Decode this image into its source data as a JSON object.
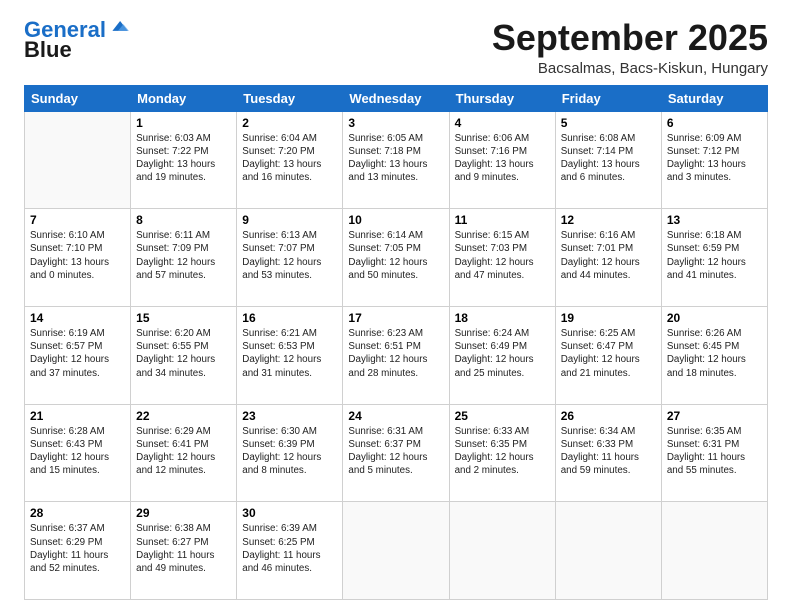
{
  "header": {
    "logo_line1": "General",
    "logo_line2": "Blue",
    "month": "September 2025",
    "location": "Bacsalmas, Bacs-Kiskun, Hungary"
  },
  "weekdays": [
    "Sunday",
    "Monday",
    "Tuesday",
    "Wednesday",
    "Thursday",
    "Friday",
    "Saturday"
  ],
  "weeks": [
    [
      {
        "num": "",
        "text": ""
      },
      {
        "num": "1",
        "text": "Sunrise: 6:03 AM\nSunset: 7:22 PM\nDaylight: 13 hours\nand 19 minutes."
      },
      {
        "num": "2",
        "text": "Sunrise: 6:04 AM\nSunset: 7:20 PM\nDaylight: 13 hours\nand 16 minutes."
      },
      {
        "num": "3",
        "text": "Sunrise: 6:05 AM\nSunset: 7:18 PM\nDaylight: 13 hours\nand 13 minutes."
      },
      {
        "num": "4",
        "text": "Sunrise: 6:06 AM\nSunset: 7:16 PM\nDaylight: 13 hours\nand 9 minutes."
      },
      {
        "num": "5",
        "text": "Sunrise: 6:08 AM\nSunset: 7:14 PM\nDaylight: 13 hours\nand 6 minutes."
      },
      {
        "num": "6",
        "text": "Sunrise: 6:09 AM\nSunset: 7:12 PM\nDaylight: 13 hours\nand 3 minutes."
      }
    ],
    [
      {
        "num": "7",
        "text": "Sunrise: 6:10 AM\nSunset: 7:10 PM\nDaylight: 13 hours\nand 0 minutes."
      },
      {
        "num": "8",
        "text": "Sunrise: 6:11 AM\nSunset: 7:09 PM\nDaylight: 12 hours\nand 57 minutes."
      },
      {
        "num": "9",
        "text": "Sunrise: 6:13 AM\nSunset: 7:07 PM\nDaylight: 12 hours\nand 53 minutes."
      },
      {
        "num": "10",
        "text": "Sunrise: 6:14 AM\nSunset: 7:05 PM\nDaylight: 12 hours\nand 50 minutes."
      },
      {
        "num": "11",
        "text": "Sunrise: 6:15 AM\nSunset: 7:03 PM\nDaylight: 12 hours\nand 47 minutes."
      },
      {
        "num": "12",
        "text": "Sunrise: 6:16 AM\nSunset: 7:01 PM\nDaylight: 12 hours\nand 44 minutes."
      },
      {
        "num": "13",
        "text": "Sunrise: 6:18 AM\nSunset: 6:59 PM\nDaylight: 12 hours\nand 41 minutes."
      }
    ],
    [
      {
        "num": "14",
        "text": "Sunrise: 6:19 AM\nSunset: 6:57 PM\nDaylight: 12 hours\nand 37 minutes."
      },
      {
        "num": "15",
        "text": "Sunrise: 6:20 AM\nSunset: 6:55 PM\nDaylight: 12 hours\nand 34 minutes."
      },
      {
        "num": "16",
        "text": "Sunrise: 6:21 AM\nSunset: 6:53 PM\nDaylight: 12 hours\nand 31 minutes."
      },
      {
        "num": "17",
        "text": "Sunrise: 6:23 AM\nSunset: 6:51 PM\nDaylight: 12 hours\nand 28 minutes."
      },
      {
        "num": "18",
        "text": "Sunrise: 6:24 AM\nSunset: 6:49 PM\nDaylight: 12 hours\nand 25 minutes."
      },
      {
        "num": "19",
        "text": "Sunrise: 6:25 AM\nSunset: 6:47 PM\nDaylight: 12 hours\nand 21 minutes."
      },
      {
        "num": "20",
        "text": "Sunrise: 6:26 AM\nSunset: 6:45 PM\nDaylight: 12 hours\nand 18 minutes."
      }
    ],
    [
      {
        "num": "21",
        "text": "Sunrise: 6:28 AM\nSunset: 6:43 PM\nDaylight: 12 hours\nand 15 minutes."
      },
      {
        "num": "22",
        "text": "Sunrise: 6:29 AM\nSunset: 6:41 PM\nDaylight: 12 hours\nand 12 minutes."
      },
      {
        "num": "23",
        "text": "Sunrise: 6:30 AM\nSunset: 6:39 PM\nDaylight: 12 hours\nand 8 minutes."
      },
      {
        "num": "24",
        "text": "Sunrise: 6:31 AM\nSunset: 6:37 PM\nDaylight: 12 hours\nand 5 minutes."
      },
      {
        "num": "25",
        "text": "Sunrise: 6:33 AM\nSunset: 6:35 PM\nDaylight: 12 hours\nand 2 minutes."
      },
      {
        "num": "26",
        "text": "Sunrise: 6:34 AM\nSunset: 6:33 PM\nDaylight: 11 hours\nand 59 minutes."
      },
      {
        "num": "27",
        "text": "Sunrise: 6:35 AM\nSunset: 6:31 PM\nDaylight: 11 hours\nand 55 minutes."
      }
    ],
    [
      {
        "num": "28",
        "text": "Sunrise: 6:37 AM\nSunset: 6:29 PM\nDaylight: 11 hours\nand 52 minutes."
      },
      {
        "num": "29",
        "text": "Sunrise: 6:38 AM\nSunset: 6:27 PM\nDaylight: 11 hours\nand 49 minutes."
      },
      {
        "num": "30",
        "text": "Sunrise: 6:39 AM\nSunset: 6:25 PM\nDaylight: 11 hours\nand 46 minutes."
      },
      {
        "num": "",
        "text": ""
      },
      {
        "num": "",
        "text": ""
      },
      {
        "num": "",
        "text": ""
      },
      {
        "num": "",
        "text": ""
      }
    ]
  ]
}
